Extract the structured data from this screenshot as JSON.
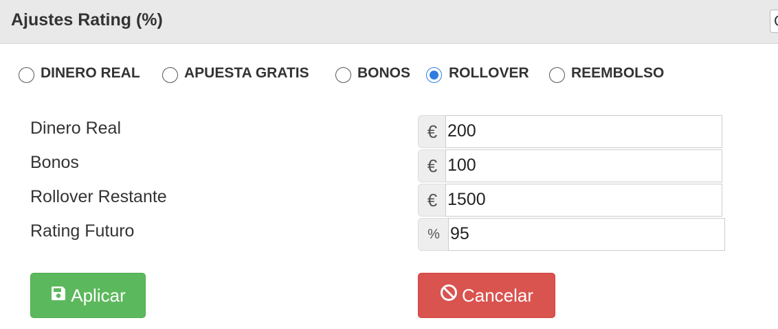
{
  "header": {
    "title": "Ajustes Rating (%)",
    "close_glyph": "C"
  },
  "radio_group": {
    "options": [
      {
        "label": "DINERO REAL",
        "checked": false
      },
      {
        "label": "APUESTA GRATIS",
        "checked": false
      },
      {
        "label": "BONOS",
        "checked": false
      },
      {
        "label": "ROLLOVER",
        "checked": true
      },
      {
        "label": "REEMBOLSO",
        "checked": false
      }
    ]
  },
  "fields": [
    {
      "label": "Dinero Real",
      "addon": "€",
      "value": "200"
    },
    {
      "label": "Bonos",
      "addon": "€",
      "value": "100"
    },
    {
      "label": "Rollover Restante",
      "addon": "€",
      "value": "1500"
    },
    {
      "label": "Rating Futuro",
      "addon": "%",
      "value": "95"
    }
  ],
  "buttons": {
    "apply_label": "Aplicar",
    "apply_icon": "floppy-disk-icon",
    "cancel_label": "Cancelar",
    "cancel_icon": "ban-icon"
  },
  "colors": {
    "header_bg": "#e9e9e9",
    "radio_checked": "#2f7de1",
    "apply_bg": "#5cb85c",
    "cancel_bg": "#d9534f"
  }
}
